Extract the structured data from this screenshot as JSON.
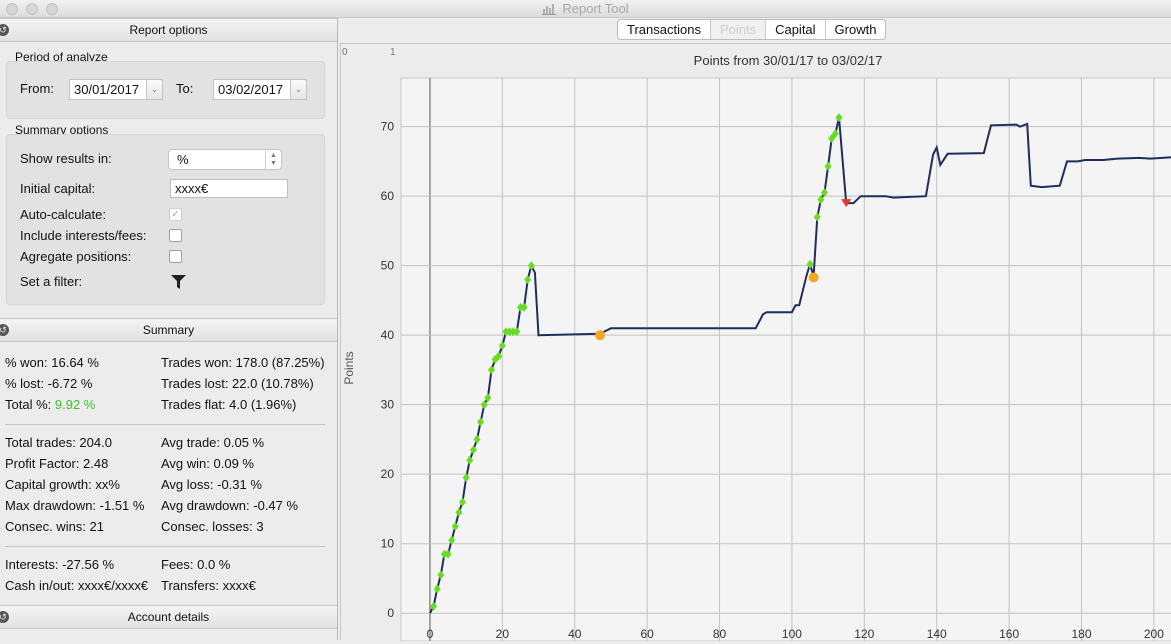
{
  "window": {
    "title": "Report Tool"
  },
  "report_options": {
    "header": "Report options",
    "period": {
      "title": "Period of analyze",
      "from_label": "From:",
      "from_value": "30/01/2017",
      "to_label": "To:",
      "to_value": "03/02/2017"
    },
    "summary_options": {
      "title": "Summary options",
      "show_results_label": "Show results in:",
      "show_results_value": "%",
      "initial_capital_label": "Initial capital:",
      "initial_capital_value": "xxxx€",
      "auto_calculate_label": "Auto-calculate:",
      "auto_calculate_checked": true,
      "include_interests_label": "Include interests/fees:",
      "include_interests_checked": false,
      "aggregate_label": "Agregate positions:",
      "aggregate_checked": false,
      "filter_label": "Set a filter:"
    }
  },
  "summary": {
    "header": "Summary",
    "won_pct": "% won: 16.64 %",
    "lost_pct": "% lost: -6.72 %",
    "total_label": "Total %:",
    "total_value": "9.92 %",
    "trades_won": "Trades won: 178.0 (87.25%)",
    "trades_lost": "Trades lost: 22.0 (10.78%)",
    "trades_flat": "Trades flat: 4.0 (1.96%)",
    "total_trades": "Total trades: 204.0",
    "profit_factor": "Profit Factor: 2.48",
    "capital_growth": "Capital growth: xx%",
    "max_drawdown": "Max drawdown: -1.51 %",
    "consec_wins": "Consec. wins: 21",
    "avg_trade": "Avg trade: 0.05 %",
    "avg_win": "Avg win: 0.09 %",
    "avg_loss": "Avg loss: -0.31 %",
    "avg_drawdown": "Avg drawdown: -0.47 %",
    "consec_losses": "Consec. losses: 3",
    "interests": "Interests: -27.56 %",
    "cash_inout": "Cash in/out: xxxx€/xxxx€",
    "fees": "Fees: 0.0 %",
    "transfers": "Transfers: xxxx€"
  },
  "account_details": {
    "header": "Account details"
  },
  "tabs": [
    {
      "label": "Transactions",
      "active": false
    },
    {
      "label": "Points",
      "active": true
    },
    {
      "label": "Capital",
      "active": false
    },
    {
      "label": "Growth",
      "active": false
    }
  ],
  "corner_labels": {
    "left": "0",
    "right": "1"
  },
  "colors": {
    "line": "#1f2d5a",
    "win_marker": "#66dd22",
    "loss_marker": "#e23a2a",
    "neutral_marker": "#f5a623",
    "total_positive": "#3bbf2c"
  },
  "chart_data": {
    "type": "line",
    "title": "Points from 30/01/17 to 03/02/17",
    "xlabel": "",
    "ylabel": "Points",
    "xlim": [
      -8,
      205
    ],
    "ylim": [
      -4,
      77
    ],
    "xticks": [
      0,
      20,
      40,
      60,
      80,
      100,
      120,
      140,
      160,
      180,
      200
    ],
    "yticks": [
      0,
      10,
      20,
      30,
      40,
      50,
      60,
      70
    ],
    "grid": true,
    "series": [
      {
        "values": [
          [
            0,
            0
          ],
          [
            1,
            1
          ],
          [
            2,
            3.5
          ],
          [
            3,
            5.5
          ],
          [
            4,
            8.5
          ],
          [
            5,
            8.5
          ],
          [
            6,
            10.5
          ],
          [
            7,
            12.5
          ],
          [
            8,
            14.5
          ],
          [
            9,
            16
          ],
          [
            10,
            19.5
          ],
          [
            11,
            22
          ],
          [
            12,
            23.5
          ],
          [
            13,
            25
          ],
          [
            14,
            27.5
          ],
          [
            15,
            30
          ],
          [
            16,
            31
          ],
          [
            17,
            35
          ],
          [
            18,
            36.5
          ],
          [
            19,
            37
          ],
          [
            20,
            38.5
          ],
          [
            21,
            40.5
          ],
          [
            22,
            40.5
          ],
          [
            23,
            40.5
          ],
          [
            24,
            40.5
          ],
          [
            25,
            44
          ],
          [
            26,
            44
          ],
          [
            27,
            48
          ],
          [
            28,
            50
          ],
          [
            29,
            49
          ],
          [
            30,
            40
          ],
          [
            47,
            40.2
          ],
          [
            50,
            41
          ],
          [
            90,
            41
          ],
          [
            92,
            43
          ],
          [
            93,
            43.3
          ],
          [
            100,
            43.3
          ],
          [
            101,
            44.3
          ],
          [
            102,
            44.3
          ],
          [
            104,
            48.5
          ],
          [
            105,
            50.2
          ],
          [
            106,
            48.5
          ],
          [
            107,
            57
          ],
          [
            108,
            59.5
          ],
          [
            109,
            60.5
          ],
          [
            110,
            64.3
          ],
          [
            111,
            68.3
          ],
          [
            112,
            69
          ],
          [
            113,
            71.3
          ],
          [
            115,
            59
          ],
          [
            117,
            59
          ],
          [
            119,
            60
          ],
          [
            126,
            60
          ],
          [
            128,
            59.8
          ],
          [
            137,
            60
          ],
          [
            139,
            66
          ],
          [
            140,
            67
          ],
          [
            141,
            64.5
          ],
          [
            143,
            66.1
          ],
          [
            153,
            66.2
          ],
          [
            155,
            70.2
          ],
          [
            162,
            70.3
          ],
          [
            163,
            70
          ],
          [
            165,
            70.4
          ],
          [
            166,
            61.5
          ],
          [
            169,
            61.3
          ],
          [
            174,
            61.5
          ],
          [
            176,
            65
          ],
          [
            179,
            65
          ],
          [
            181,
            65.2
          ],
          [
            186,
            65.2
          ],
          [
            190,
            65.4
          ],
          [
            196,
            65.5
          ],
          [
            199,
            65.4
          ],
          [
            205,
            65.6
          ]
        ]
      }
    ],
    "win_markers": [
      [
        1,
        1
      ],
      [
        2,
        3.5
      ],
      [
        3,
        5.5
      ],
      [
        4,
        8.5
      ],
      [
        5,
        8.5
      ],
      [
        6,
        10.5
      ],
      [
        7,
        12.5
      ],
      [
        8,
        14.5
      ],
      [
        9,
        16
      ],
      [
        10,
        19.5
      ],
      [
        11,
        22
      ],
      [
        12,
        23.5
      ],
      [
        13,
        25
      ],
      [
        14,
        27.5
      ],
      [
        15,
        30
      ],
      [
        16,
        31
      ],
      [
        17,
        35
      ],
      [
        18,
        36.5
      ],
      [
        19,
        37
      ],
      [
        20,
        38.5
      ],
      [
        21,
        40.5
      ],
      [
        22,
        40.5
      ],
      [
        23,
        40.5
      ],
      [
        24,
        40.5
      ],
      [
        25,
        44
      ],
      [
        26,
        44
      ],
      [
        27,
        48
      ],
      [
        28,
        50
      ],
      [
        105,
        50.2
      ],
      [
        107,
        57
      ],
      [
        108,
        59.5
      ],
      [
        109,
        60.5
      ],
      [
        110,
        64.3
      ],
      [
        111,
        68.3
      ],
      [
        112,
        69
      ],
      [
        113,
        71.3
      ]
    ],
    "loss_markers": [
      [
        115,
        59
      ]
    ],
    "neutral_markers": [
      [
        47,
        40
      ],
      [
        106,
        48.3
      ]
    ]
  }
}
